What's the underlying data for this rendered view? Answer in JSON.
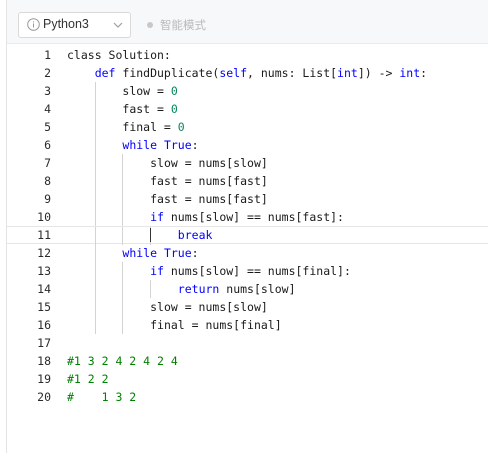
{
  "toolbar": {
    "language": "Python3",
    "smart_mode_label": "智能模式"
  },
  "editor": {
    "lines": [
      {
        "n": "1",
        "indent": 0,
        "tokens": [
          {
            "t": "class Solution:",
            "c": ""
          }
        ]
      },
      {
        "n": "2",
        "indent": 4,
        "tokens": [
          {
            "t": "def ",
            "c": "kw"
          },
          {
            "t": "findDuplicate(",
            "c": ""
          },
          {
            "t": "self",
            "c": "kw"
          },
          {
            "t": ", nums: List[",
            "c": ""
          },
          {
            "t": "int",
            "c": "kw"
          },
          {
            "t": "]) -> ",
            "c": ""
          },
          {
            "t": "int",
            "c": "kw"
          },
          {
            "t": ":",
            "c": ""
          }
        ]
      },
      {
        "n": "3",
        "indent": 8,
        "tokens": [
          {
            "t": "slow = ",
            "c": ""
          },
          {
            "t": "0",
            "c": "num"
          }
        ]
      },
      {
        "n": "4",
        "indent": 8,
        "tokens": [
          {
            "t": "fast = ",
            "c": ""
          },
          {
            "t": "0",
            "c": "num"
          }
        ]
      },
      {
        "n": "5",
        "indent": 8,
        "tokens": [
          {
            "t": "final = ",
            "c": ""
          },
          {
            "t": "0",
            "c": "num"
          }
        ]
      },
      {
        "n": "6",
        "indent": 8,
        "tokens": [
          {
            "t": "while ",
            "c": "kw"
          },
          {
            "t": "True",
            "c": "kw"
          },
          {
            "t": ":",
            "c": ""
          }
        ]
      },
      {
        "n": "7",
        "indent": 12,
        "tokens": [
          {
            "t": "slow = nums[slow]",
            "c": ""
          }
        ]
      },
      {
        "n": "8",
        "indent": 12,
        "tokens": [
          {
            "t": "fast = nums[fast]",
            "c": ""
          }
        ]
      },
      {
        "n": "9",
        "indent": 12,
        "tokens": [
          {
            "t": "fast = nums[fast]",
            "c": ""
          }
        ]
      },
      {
        "n": "10",
        "indent": 12,
        "tokens": [
          {
            "t": "if ",
            "c": "kw"
          },
          {
            "t": "nums[slow] == nums[fast]:",
            "c": ""
          }
        ]
      },
      {
        "n": "11",
        "indent": 16,
        "active": true,
        "tokens": [
          {
            "t": "break",
            "c": "kw"
          }
        ]
      },
      {
        "n": "12",
        "indent": 8,
        "tokens": [
          {
            "t": "while ",
            "c": "kw"
          },
          {
            "t": "True",
            "c": "kw"
          },
          {
            "t": ":",
            "c": ""
          }
        ]
      },
      {
        "n": "13",
        "indent": 12,
        "tokens": [
          {
            "t": "if ",
            "c": "kw"
          },
          {
            "t": "nums[slow] == nums[final]:",
            "c": ""
          }
        ]
      },
      {
        "n": "14",
        "indent": 16,
        "tokens": [
          {
            "t": "return ",
            "c": "kw"
          },
          {
            "t": "nums[slow]",
            "c": ""
          }
        ]
      },
      {
        "n": "15",
        "indent": 12,
        "tokens": [
          {
            "t": "slow = nums[slow]",
            "c": ""
          }
        ]
      },
      {
        "n": "16",
        "indent": 12,
        "tokens": [
          {
            "t": "final = nums[final]",
            "c": ""
          }
        ]
      },
      {
        "n": "17",
        "indent": 0,
        "tokens": []
      },
      {
        "n": "18",
        "indent": 0,
        "tokens": [
          {
            "t": "#1 3 2 4 2 4 2 4",
            "c": "cm"
          }
        ]
      },
      {
        "n": "19",
        "indent": 0,
        "tokens": [
          {
            "t": "#1 2 2",
            "c": "cm"
          }
        ]
      },
      {
        "n": "20",
        "indent": 0,
        "tokens": [
          {
            "t": "#    1 3 2",
            "c": "cm"
          }
        ]
      }
    ]
  },
  "colors": {
    "keyword": "#0000ff",
    "number": "#098658",
    "comment": "#008000"
  }
}
